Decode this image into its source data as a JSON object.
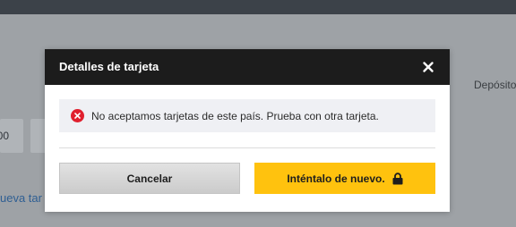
{
  "background": {
    "right_text": "Depósito",
    "amount_text": "00",
    "link_text": "ueva tar"
  },
  "modal": {
    "title": "Detalles de tarjeta",
    "close_icon": "close-icon",
    "alert": {
      "icon": "error-icon",
      "message": "No aceptamos tarjetas de este país. Prueba con otra tarjeta."
    },
    "buttons": {
      "cancel_label": "Cancelar",
      "retry_label": "Inténtalo de nuevo.",
      "retry_icon": "lock-icon"
    }
  },
  "colors": {
    "header_bg": "#1c1c1c",
    "accent_yellow": "#ffc20e",
    "error_red": "#e0202e",
    "overlay_bg": "#9ea2a6"
  }
}
